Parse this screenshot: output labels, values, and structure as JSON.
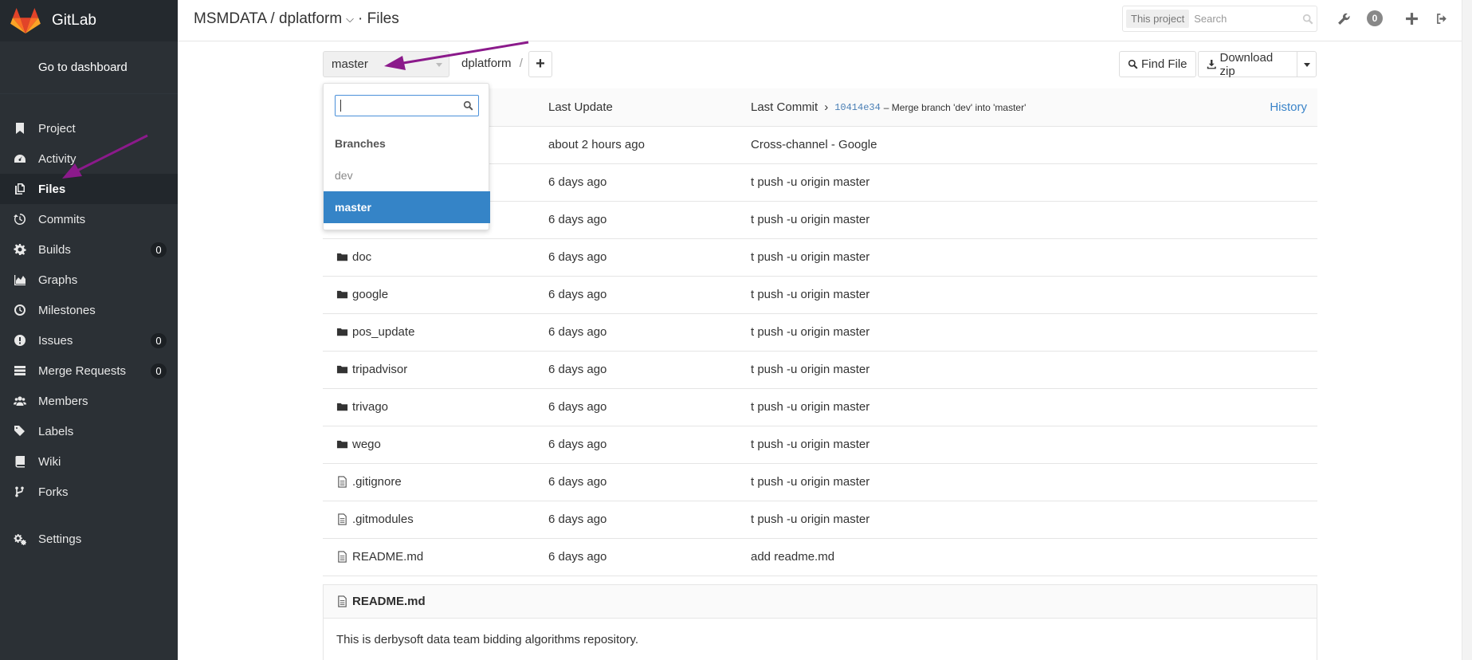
{
  "brand": {
    "name": "GitLab"
  },
  "sidebar": {
    "dashboard": "Go to dashboard",
    "items": [
      {
        "label": "Project",
        "icon": "bookmark-icon"
      },
      {
        "label": "Activity",
        "icon": "dashboard-icon"
      },
      {
        "label": "Files",
        "icon": "files-icon",
        "active": true
      },
      {
        "label": "Commits",
        "icon": "history-icon"
      },
      {
        "label": "Builds",
        "icon": "builds-icon",
        "badge": "0"
      },
      {
        "label": "Graphs",
        "icon": "area-chart-icon"
      },
      {
        "label": "Milestones",
        "icon": "clock-icon"
      },
      {
        "label": "Issues",
        "icon": "exclamation-icon",
        "badge": "0"
      },
      {
        "label": "Merge Requests",
        "icon": "tasks-icon",
        "badge": "0"
      },
      {
        "label": "Members",
        "icon": "users-icon"
      },
      {
        "label": "Labels",
        "icon": "tags-icon"
      },
      {
        "label": "Wiki",
        "icon": "book-icon"
      },
      {
        "label": "Forks",
        "icon": "code-fork-icon"
      }
    ],
    "settings": "Settings"
  },
  "header": {
    "breadcrumb": "MSMDATA / dplatform",
    "page": "· Files",
    "search_scope": "This project",
    "search_placeholder": "Search",
    "todo_count": "0"
  },
  "toolbar": {
    "branch": "master",
    "path": "dplatform",
    "path_sep": "/",
    "add": "+",
    "find_file": "Find File",
    "download": "Download zip"
  },
  "table": {
    "col_update": "Last Update",
    "col_commit": "Last Commit",
    "commit_sha": "10414e34",
    "commit_msg": "– Merge branch 'dev' into 'master'",
    "history": "History",
    "rows": [
      {
        "name": "",
        "type": "folder",
        "updated": "about 2 hours ago",
        "commit": "Cross-channel - Google"
      },
      {
        "name": "",
        "type": "folder",
        "updated": "6 days ago",
        "commit": "t push -u origin master"
      },
      {
        "name": "",
        "type": "folder",
        "updated": "6 days ago",
        "commit": "t push -u origin master"
      },
      {
        "name": "doc",
        "type": "folder",
        "updated": "6 days ago",
        "commit": "t push -u origin master"
      },
      {
        "name": "google",
        "type": "folder",
        "updated": "6 days ago",
        "commit": "t push -u origin master"
      },
      {
        "name": "pos_update",
        "type": "folder",
        "updated": "6 days ago",
        "commit": "t push -u origin master"
      },
      {
        "name": "tripadvisor",
        "type": "folder",
        "updated": "6 days ago",
        "commit": "t push -u origin master"
      },
      {
        "name": "trivago",
        "type": "folder",
        "updated": "6 days ago",
        "commit": "t push -u origin master"
      },
      {
        "name": "wego",
        "type": "folder",
        "updated": "6 days ago",
        "commit": "t push -u origin master"
      },
      {
        "name": ".gitignore",
        "type": "file",
        "updated": "6 days ago",
        "commit": "t push -u origin master"
      },
      {
        "name": ".gitmodules",
        "type": "file",
        "updated": "6 days ago",
        "commit": "t push -u origin master"
      },
      {
        "name": "README.md",
        "type": "file",
        "updated": "6 days ago",
        "commit": "add readme.md"
      }
    ]
  },
  "readme": {
    "title": "README.md",
    "body": "This is derbysoft data team bidding algorithms repository."
  },
  "dropdown": {
    "search_value": "",
    "header": "Branches",
    "items": [
      {
        "label": "dev",
        "selected": false
      },
      {
        "label": "master",
        "selected": true
      }
    ]
  },
  "colors": {
    "sidebar_bg": "#2b3035",
    "accent": "#3584c7",
    "link": "#3a84c9",
    "annotation_arrow": "#8b1a8b"
  }
}
